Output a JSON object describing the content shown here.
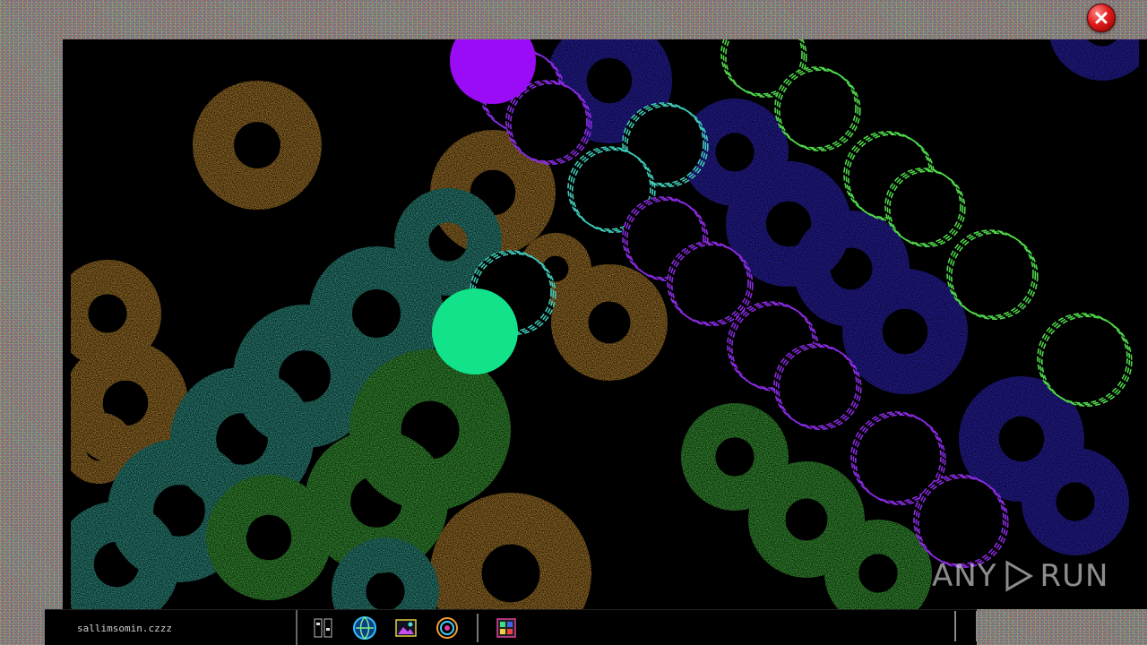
{
  "window": {
    "close_label": "Close"
  },
  "watermark": {
    "text": "ANY RUN"
  },
  "taskbar": {
    "task_text": "sallimsomin.czzz",
    "tray_icons": [
      "app-icon",
      "globe-icon",
      "photo-icon",
      "swirl-icon",
      "media-icon"
    ]
  },
  "colors": {
    "canvas_bg": "#000000",
    "close_red": "#e01b1b",
    "orange": "#e7a63a",
    "teal": "#3fc9b6",
    "green": "#4fd84a",
    "blue": "#3a2df0",
    "violet": "#8a2be2",
    "mint": "#12e38a",
    "purple_solid": "#9a0cf5"
  }
}
